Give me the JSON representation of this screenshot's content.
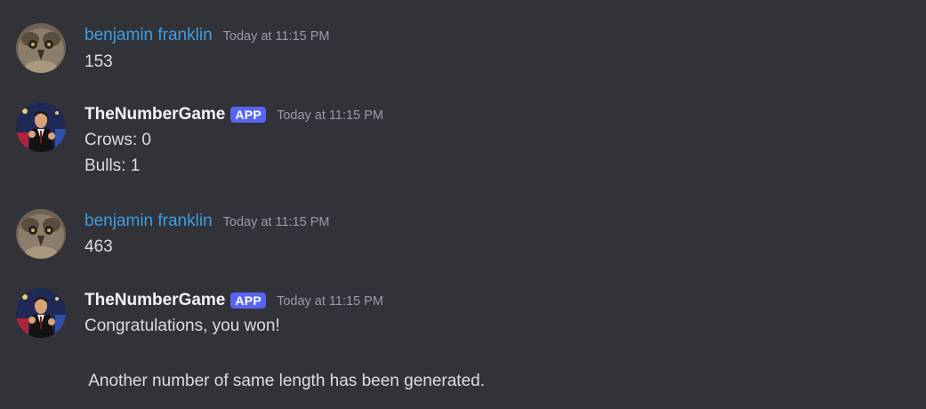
{
  "messages": [
    {
      "author": "benjamin franklin",
      "timestamp": "Today at 11:15 PM",
      "lines": [
        "153"
      ]
    },
    {
      "author": "TheNumberGame",
      "badge": "APP",
      "timestamp": "Today at 11:15 PM",
      "lines": [
        "Crows: 0",
        "Bulls: 1"
      ]
    },
    {
      "author": "benjamin franklin",
      "timestamp": "Today at 11:15 PM",
      "lines": [
        "463"
      ]
    },
    {
      "author": "TheNumberGame",
      "badge": "APP",
      "timestamp": "Today at 11:15 PM",
      "lines": [
        "Congratulations, you won!",
        " Another number of same length has been generated."
      ]
    }
  ],
  "colors": {
    "background": "#323339",
    "human_username": "#3d9de2",
    "bot_username": "#f2f3f5",
    "app_badge": "#5865f2",
    "timestamp": "#9a9ca5",
    "message_text": "#dbdee1"
  },
  "icons": {
    "human_avatar": "owl-avatar-icon",
    "bot_avatar": "man-in-suit-avatar-icon"
  }
}
